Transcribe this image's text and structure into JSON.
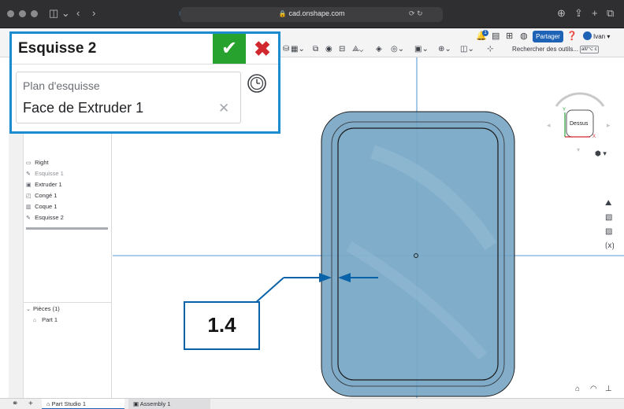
{
  "browser": {
    "url": "cad.onshape.com"
  },
  "toolbar": {
    "share_label": "Partager",
    "search_tools": "Rechercher des outils...",
    "shortcut": "alt/⌥ c",
    "user_name": "Ivan",
    "notification_count": "1"
  },
  "dialog": {
    "title": "Esquisse 2",
    "field_label": "Plan d'esquisse",
    "field_value": "Face de Extruder 1",
    "ok_symbol": "✔",
    "cancel_symbol": "✖"
  },
  "tree": {
    "items": [
      {
        "label": "Right",
        "icon": "plane-icon"
      },
      {
        "label": "Esquisse 1",
        "icon": "sketch-icon"
      },
      {
        "label": "Extruder 1",
        "icon": "extrude-icon"
      },
      {
        "label": "Congé 1",
        "icon": "fillet-icon"
      },
      {
        "label": "Coque 1",
        "icon": "shell-icon"
      },
      {
        "label": "Esquisse 2",
        "icon": "sketch-icon"
      }
    ],
    "parts_header": "Pièces (1)",
    "parts": [
      {
        "label": "Part 1"
      }
    ]
  },
  "viewcube": {
    "face_label": "Dessus",
    "x_axis": "X",
    "y_axis": "Y"
  },
  "dimension": {
    "value": "1.4"
  },
  "tabs": [
    {
      "label": "Part Studio 1",
      "active": true
    },
    {
      "label": "Assembly 1",
      "active": false
    }
  ],
  "colors": {
    "accent": "#1e63b6",
    "dialog_border": "#1a8ccf",
    "ok": "#27a22e",
    "cancel": "#d0282d",
    "part_fill": "#6e9fbf",
    "dimension": "#0a62a8"
  }
}
